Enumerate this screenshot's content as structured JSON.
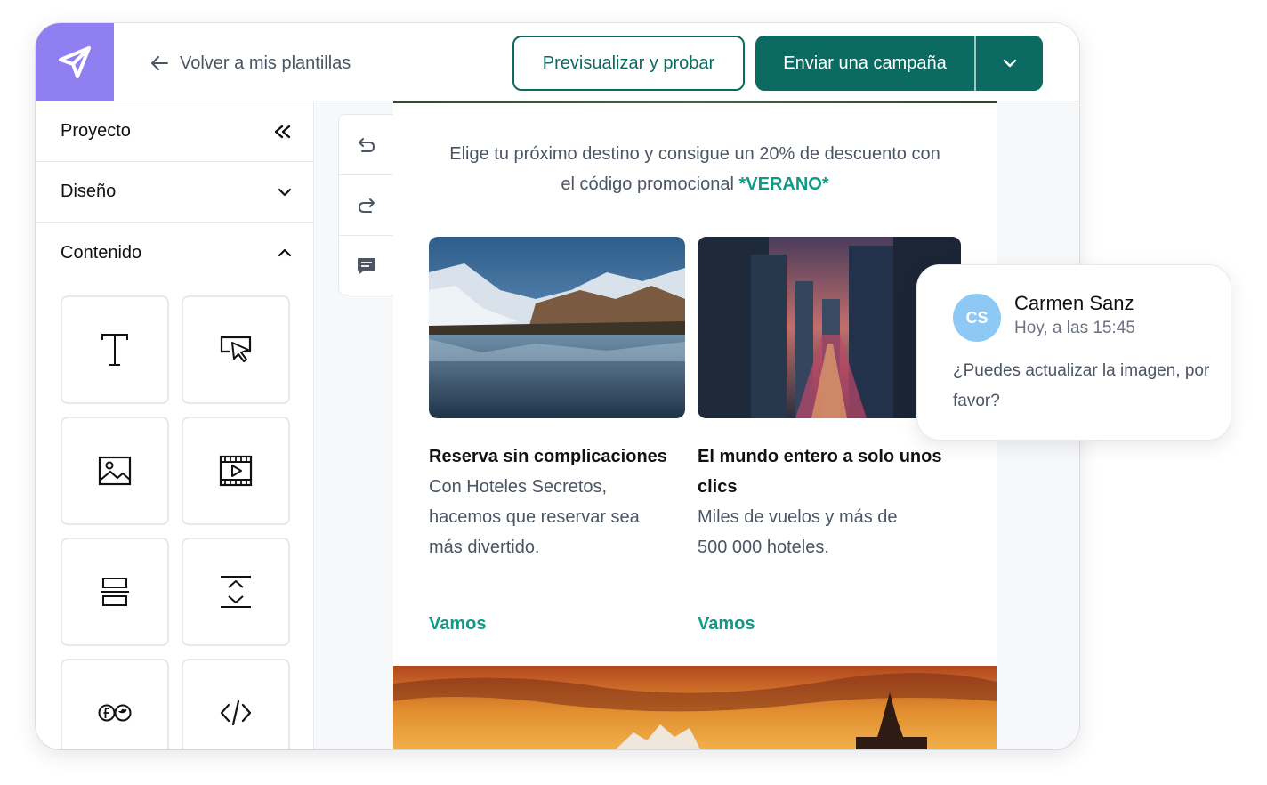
{
  "header": {
    "back_label": "Volver a mis plantillas",
    "preview_label": "Previsualizar y probar",
    "send_label": "Enviar una campaña"
  },
  "sidebar": {
    "sections": [
      {
        "label": "Proyecto",
        "icon": "double-chevron-left-icon"
      },
      {
        "label": "Diseño",
        "icon": "chevron-down-icon"
      },
      {
        "label": "Contenido",
        "icon": "chevron-up-icon"
      }
    ],
    "blocks": [
      "text-block-icon",
      "button-block-icon",
      "image-block-icon",
      "video-block-icon",
      "divider-block-icon",
      "spacer-block-icon",
      "social-block-icon",
      "html-block-icon"
    ]
  },
  "tools": [
    "undo-icon",
    "redo-icon",
    "comment-icon"
  ],
  "email": {
    "promo_line1": "Elige tu próximo destino y consigue un 20% de descuento con",
    "promo_line2_prefix": "el código promocional ",
    "promo_code": "*VERANO*",
    "cards": [
      {
        "title": "Reserva sin complicaciones",
        "text_lines": [
          "Con Hoteles Secretos,",
          "hacemos que reservar sea",
          "más divertido."
        ],
        "link": "Vamos"
      },
      {
        "title_lines": [
          "El mundo entero a solo unos",
          "clics"
        ],
        "text_lines": [
          "Miles de vuelos y más de",
          "500 000 hoteles."
        ],
        "link": "Vamos"
      }
    ]
  },
  "comment": {
    "initials": "CS",
    "author": "Carmen Sanz",
    "time": "Hoy, a las 15:45",
    "text": "¿Puedes actualizar la imagen, por favor?"
  },
  "colors": {
    "brand_purple": "#8f7ff0",
    "primary_teal": "#0b6b63",
    "accent_green": "#0f9a86",
    "avatar_blue": "#8ec8f5"
  }
}
